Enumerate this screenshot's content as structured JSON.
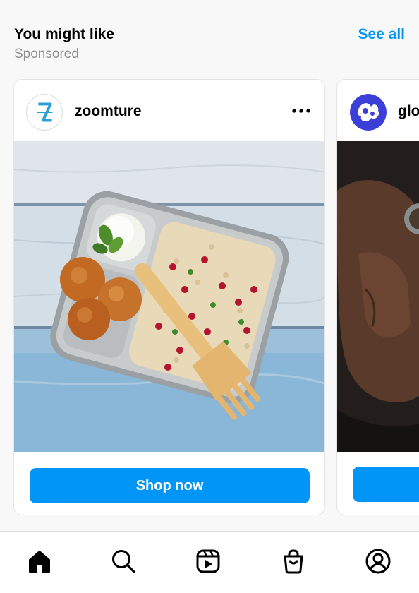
{
  "section": {
    "title": "You might like",
    "subtitle": "Sponsored",
    "see_all": "See all"
  },
  "cards": [
    {
      "username": "zoomture",
      "avatar_icon": "zoomture-logo-icon",
      "media": "food-lunchbox-photo",
      "cta_label": "Shop now"
    },
    {
      "username": "glo",
      "avatar_icon": "glo-logo-icon",
      "media": "hand-holding-bowl-photo",
      "cta_label": ""
    }
  ],
  "tabbar": {
    "items": [
      "home-icon",
      "search-icon",
      "reels-icon",
      "shop-icon",
      "profile-icon"
    ],
    "active": "home-icon"
  },
  "colors": {
    "accent": "#0095f6",
    "muted_text": "#8e8e8e",
    "background": "#f8f8f8"
  }
}
